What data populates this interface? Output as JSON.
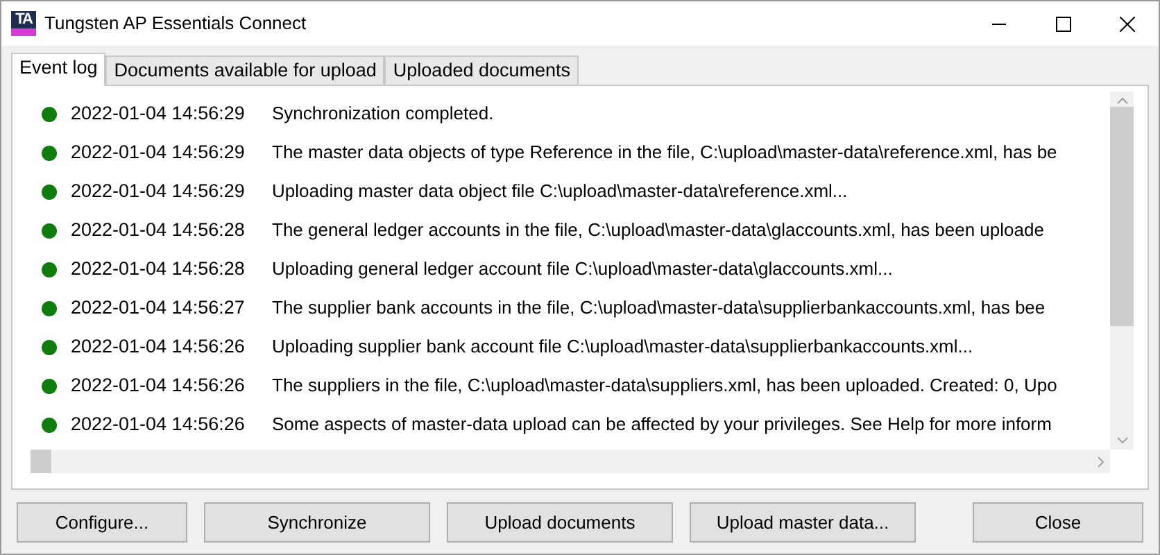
{
  "window": {
    "title": "Tungsten AP Essentials Connect",
    "logo": "TA"
  },
  "tabs": [
    {
      "label": "Event log",
      "selected": true
    },
    {
      "label": "Documents available for upload",
      "selected": false
    },
    {
      "label": "Uploaded documents",
      "selected": false
    }
  ],
  "events": [
    {
      "color": "#107c10",
      "time": "2022-01-04 14:56:29",
      "message": "Synchronization completed."
    },
    {
      "color": "#107c10",
      "time": "2022-01-04 14:56:29",
      "message": "The master data objects of type Reference in the file, C:\\upload\\master-data\\reference.xml, has be"
    },
    {
      "color": "#107c10",
      "time": "2022-01-04 14:56:29",
      "message": "Uploading master data object file C:\\upload\\master-data\\reference.xml..."
    },
    {
      "color": "#107c10",
      "time": "2022-01-04 14:56:28",
      "message": "The general ledger accounts in the file, C:\\upload\\master-data\\glaccounts.xml, has been uploade"
    },
    {
      "color": "#107c10",
      "time": "2022-01-04 14:56:28",
      "message": "Uploading general ledger account file C:\\upload\\master-data\\glaccounts.xml..."
    },
    {
      "color": "#107c10",
      "time": "2022-01-04 14:56:27",
      "message": "The supplier bank accounts in the file, C:\\upload\\master-data\\supplierbankaccounts.xml, has bee"
    },
    {
      "color": "#107c10",
      "time": "2022-01-04 14:56:26",
      "message": "Uploading supplier bank account file C:\\upload\\master-data\\supplierbankaccounts.xml..."
    },
    {
      "color": "#107c10",
      "time": "2022-01-04 14:56:26",
      "message": "The suppliers in the file, C:\\upload\\master-data\\suppliers.xml, has been uploaded. Created: 0, Upo"
    },
    {
      "color": "#107c10",
      "time": "2022-01-04 14:56:26",
      "message": "Some aspects of master-data upload can be affected by your privileges. See Help for more inform"
    }
  ],
  "buttons": [
    {
      "label": "Configure..."
    },
    {
      "label": "Synchronize"
    },
    {
      "label": "Upload documents"
    },
    {
      "label": "Upload master data..."
    },
    {
      "label": "Close",
      "separated": true
    }
  ]
}
